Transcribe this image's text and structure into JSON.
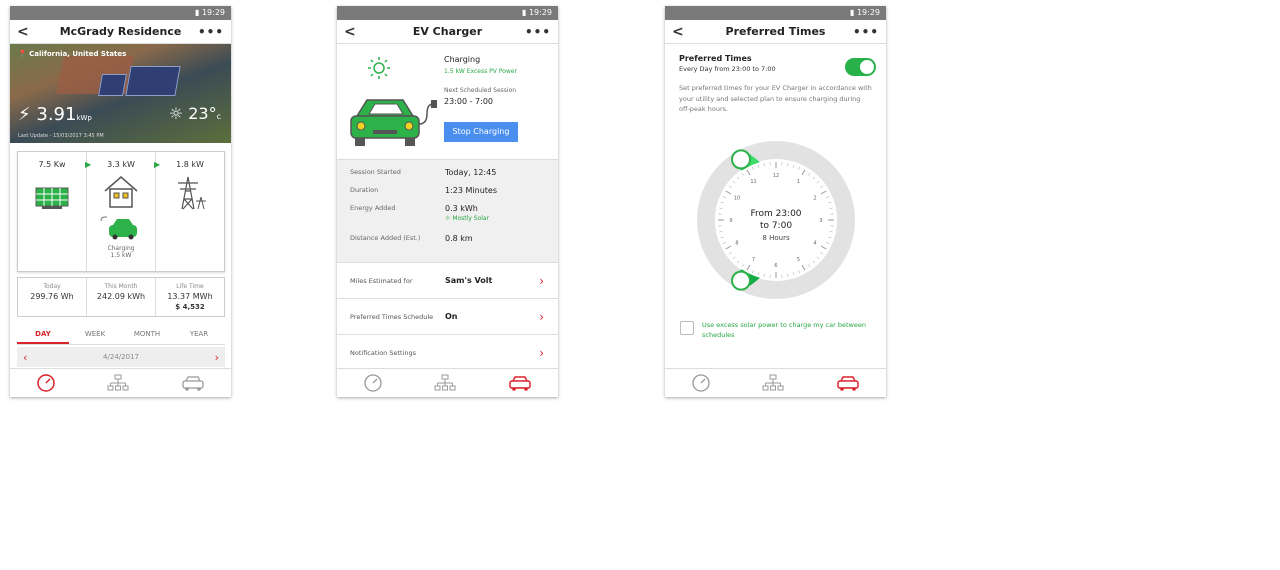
{
  "status_time": "19:29",
  "phone1": {
    "title": "McGrady Residence",
    "location": "California, United States",
    "power_value": "3.91",
    "power_unit": "kWp",
    "temperature": "23°",
    "temp_unit": "c",
    "last_update": "Last Update - 15/03/2017 3:45 PM",
    "flow": {
      "solar": "7.5 Kw",
      "home": "3.3 kW",
      "grid": "1.8 kW",
      "car_label": "Charging",
      "car_value": "1.5 kW"
    },
    "stats": [
      {
        "label": "Today",
        "value": "299.76 Wh"
      },
      {
        "label": "This Month",
        "value": "242.09 kWh"
      },
      {
        "label": "Life Time",
        "value": "13.37 MWh",
        "extra": "$ 4,532"
      }
    ],
    "tabs": [
      "DAY",
      "WEEK",
      "MONTH",
      "YEAR"
    ],
    "date": "4/24/2017"
  },
  "phone2": {
    "title": "EV Charger",
    "status": "Charging",
    "status_sub": "1.5 kW Excess PV Power",
    "next_label": "Next Scheduled Session",
    "next_value": "23:00 - 7:00",
    "stop_button": "Stop Charging",
    "session": [
      {
        "k": "Session Started",
        "v": "Today, 12:45"
      },
      {
        "k": "Duration",
        "v": "1:23 Minutes"
      },
      {
        "k": "Energy Added",
        "v": "0.3 kWh",
        "sub": "Mostly Solar"
      },
      {
        "k": "Distance Added  (Est.)",
        "v": "0.8 km"
      }
    ],
    "rows": [
      {
        "k": "Miles Estimated for",
        "v": "Sam's Volt"
      },
      {
        "k": "Preferred Times Schedule",
        "v": "On"
      },
      {
        "k": "Notification Settings",
        "v": ""
      }
    ]
  },
  "phone3": {
    "title": "Preferred Times",
    "heading": "Preferred Times",
    "subheading": "Every Day from 23:00 to 7:00",
    "description": "Set preferred times for your EV Charger in accordance with your utility and selected plan to ensure charging during off-peak hours.",
    "clock_line1": "From 23:00",
    "clock_line2": "to 7:00",
    "clock_line3": "8 Hours",
    "clock_numbers": [
      "12",
      "1",
      "2",
      "3",
      "4",
      "5",
      "6",
      "7",
      "8",
      "9",
      "10",
      "11"
    ],
    "toggle_on": true,
    "checkbox_label": "Use excess solar power to charge my car between schedules"
  },
  "colors": {
    "accent_red": "#d8232a",
    "green": "#27b148",
    "blue_button": "#4a8ff0"
  },
  "nav_icons": [
    "gauge-icon",
    "network-icon",
    "car-icon"
  ]
}
